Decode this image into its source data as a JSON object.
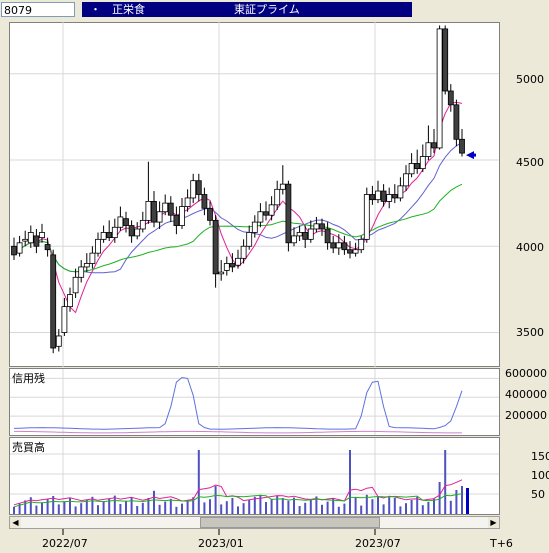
{
  "header": {
    "code": "8079",
    "dot": "・",
    "name": "正栄食",
    "market": "東証プライム"
  },
  "price_axis": [
    "5000",
    "4500",
    "4000",
    "3500"
  ],
  "credit_panel": {
    "label": "信用残",
    "ticks": [
      "600000",
      "400000",
      "200000"
    ]
  },
  "volume_panel": {
    "label": "売買高",
    "ticks": [
      "150",
      "100",
      "50"
    ]
  },
  "x_axis": [
    "2022/07",
    "2023/01",
    "2023/07",
    "T+6"
  ],
  "colors": {
    "up": "#ffffff",
    "down": "#404040",
    "ma_short": "#e0209a",
    "ma_mid": "#6060d0",
    "ma_long": "#20b020",
    "credit_buy": "#6070e0",
    "credit_sell": "#d080d0",
    "arrow": "#0000c0"
  },
  "chart_data": {
    "type": "candlestick",
    "price_ylim": [
      3300,
      5300
    ],
    "candles": [
      [
        4000,
        3950,
        4050,
        3920
      ],
      [
        3960,
        4020,
        4060,
        3940
      ],
      [
        4030,
        4040,
        4090,
        4000
      ],
      [
        4020,
        4080,
        4120,
        3990
      ],
      [
        4060,
        4000,
        4100,
        3960
      ],
      [
        4050,
        4080,
        4130,
        4020
      ],
      [
        4010,
        3980,
        4050,
        3940
      ],
      [
        3950,
        3410,
        3980,
        3380
      ],
      [
        3420,
        3480,
        3520,
        3390
      ],
      [
        3500,
        3650,
        3700,
        3480
      ],
      [
        3650,
        3720,
        3760,
        3620
      ],
      [
        3730,
        3820,
        3870,
        3700
      ],
      [
        3820,
        3880,
        3920,
        3790
      ],
      [
        3880,
        3900,
        3960,
        3850
      ],
      [
        3900,
        3960,
        4000,
        3870
      ],
      [
        3960,
        4040,
        4080,
        3940
      ],
      [
        4040,
        4080,
        4120,
        4020
      ],
      [
        4080,
        4050,
        4150,
        4030
      ],
      [
        4050,
        4110,
        4160,
        4020
      ],
      [
        4110,
        4170,
        4230,
        4090
      ],
      [
        4160,
        4120,
        4200,
        4080
      ],
      [
        4120,
        4060,
        4150,
        4020
      ],
      [
        4060,
        4100,
        4140,
        4040
      ],
      [
        4100,
        4150,
        4200,
        4080
      ],
      [
        4150,
        4260,
        4490,
        4130
      ],
      [
        4260,
        4140,
        4320,
        4110
      ],
      [
        4140,
        4200,
        4260,
        4100
      ],
      [
        4200,
        4250,
        4300,
        4180
      ],
      [
        4250,
        4180,
        4290,
        4140
      ],
      [
        4180,
        4120,
        4230,
        4070
      ],
      [
        4120,
        4230,
        4280,
        4100
      ],
      [
        4230,
        4280,
        4330,
        4200
      ],
      [
        4280,
        4380,
        4420,
        4250
      ],
      [
        4380,
        4300,
        4420,
        4260
      ],
      [
        4300,
        4220,
        4340,
        4180
      ],
      [
        4220,
        4150,
        4260,
        4120
      ],
      [
        4150,
        3840,
        4180,
        3760
      ],
      [
        3840,
        3850,
        3920,
        3800
      ],
      [
        3860,
        3900,
        3940,
        3830
      ],
      [
        3900,
        3880,
        3960,
        3850
      ],
      [
        3890,
        3930,
        3980,
        3870
      ],
      [
        3930,
        4000,
        4040,
        3900
      ],
      [
        4000,
        4080,
        4120,
        3980
      ],
      [
        4080,
        4140,
        4180,
        4050
      ],
      [
        4140,
        4200,
        4250,
        4110
      ],
      [
        4200,
        4180,
        4260,
        4150
      ],
      [
        4180,
        4240,
        4290,
        4150
      ],
      [
        4240,
        4330,
        4380,
        4210
      ],
      [
        4330,
        4360,
        4470,
        4300
      ],
      [
        4360,
        4020,
        4380,
        3970
      ],
      [
        4020,
        4060,
        4110,
        4000
      ],
      [
        4060,
        4080,
        4120,
        4030
      ],
      [
        4080,
        4040,
        4120,
        3990
      ],
      [
        4040,
        4100,
        4150,
        4020
      ],
      [
        4100,
        4130,
        4170,
        4080
      ],
      [
        4130,
        4100,
        4160,
        4060
      ],
      [
        4100,
        4020,
        4140,
        3980
      ],
      [
        4020,
        3990,
        4060,
        3960
      ],
      [
        3990,
        4020,
        4070,
        3950
      ],
      [
        4020,
        3980,
        4060,
        3950
      ],
      [
        3980,
        3960,
        4030,
        3930
      ],
      [
        3960,
        3980,
        4020,
        3940
      ],
      [
        3980,
        4040,
        4060,
        3960
      ],
      [
        4040,
        4300,
        4340,
        4020
      ],
      [
        4300,
        4270,
        4350,
        4240
      ],
      [
        4270,
        4320,
        4380,
        4250
      ],
      [
        4320,
        4260,
        4360,
        4230
      ],
      [
        4260,
        4300,
        4340,
        4220
      ],
      [
        4300,
        4280,
        4360,
        4250
      ],
      [
        4280,
        4350,
        4400,
        4260
      ],
      [
        4350,
        4420,
        4470,
        4320
      ],
      [
        4420,
        4480,
        4540,
        4400
      ],
      [
        4480,
        4450,
        4560,
        4420
      ],
      [
        4450,
        4520,
        4590,
        4430
      ],
      [
        4520,
        4600,
        4700,
        4500
      ],
      [
        4600,
        4570,
        4680,
        4540
      ],
      [
        4570,
        5260,
        5280,
        4560
      ],
      [
        5260,
        4900,
        5280,
        4880
      ],
      [
        4900,
        4820,
        4940,
        4780
      ],
      [
        4820,
        4620,
        4850,
        4580
      ],
      [
        4620,
        4540,
        4680,
        4520
      ]
    ],
    "last_price": 4540
  }
}
